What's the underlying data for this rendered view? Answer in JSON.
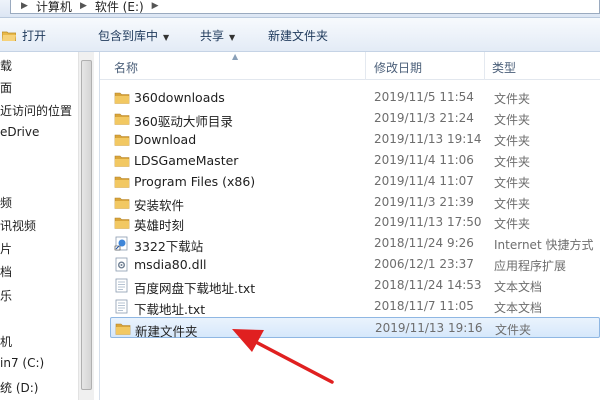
{
  "address": {
    "crumbs": [
      "计算机",
      "软件 (E:)"
    ]
  },
  "toolbar": {
    "open_label": "打开",
    "include_label": "包含到库中",
    "share_label": "共享",
    "new_folder_label": "新建文件夹"
  },
  "nav": {
    "items": [
      {
        "label": "载"
      },
      {
        "label": "面"
      },
      {
        "label": "近访问的位置"
      },
      {
        "label": "eDrive"
      },
      {
        "label": "频"
      },
      {
        "label": "讯视频"
      },
      {
        "label": "片"
      },
      {
        "label": "档"
      },
      {
        "label": "乐"
      },
      {
        "label": "机"
      },
      {
        "label": "in7 (C:)"
      },
      {
        "label": "统 (D:)"
      }
    ]
  },
  "columns": {
    "name": "名称",
    "date": "修改日期",
    "type": "类型"
  },
  "files": [
    {
      "name": "360downloads",
      "date": "2019/11/5 11:54",
      "type": "文件夹",
      "icon": "folder-icon"
    },
    {
      "name": "360驱动大师目录",
      "date": "2019/11/3 21:24",
      "type": "文件夹",
      "icon": "folder-icon"
    },
    {
      "name": "Download",
      "date": "2019/11/13 19:14",
      "type": "文件夹",
      "icon": "folder-icon"
    },
    {
      "name": "LDSGameMaster",
      "date": "2019/11/4 11:06",
      "type": "文件夹",
      "icon": "folder-icon"
    },
    {
      "name": "Program Files (x86)",
      "date": "2019/11/4 11:07",
      "type": "文件夹",
      "icon": "folder-icon"
    },
    {
      "name": "安装软件",
      "date": "2019/11/3 21:39",
      "type": "文件夹",
      "icon": "folder-icon"
    },
    {
      "name": "英雄时刻",
      "date": "2019/11/13 17:50",
      "type": "文件夹",
      "icon": "folder-icon"
    },
    {
      "name": "3322下载站",
      "date": "2018/11/24 9:26",
      "type": "Internet 快捷方式",
      "icon": "internet-shortcut-icon"
    },
    {
      "name": "msdia80.dll",
      "date": "2006/12/1 23:37",
      "type": "应用程序扩展",
      "icon": "dll-file-icon"
    },
    {
      "name": "百度网盘下载地址.txt",
      "date": "2018/11/24 14:53",
      "type": "文本文档",
      "icon": "text-file-icon"
    },
    {
      "name": "下载地址.txt",
      "date": "2018/11/7 11:05",
      "type": "文本文档",
      "icon": "text-file-icon"
    },
    {
      "name": "新建文件夹",
      "date": "2019/11/13 19:16",
      "type": "文件夹",
      "icon": "folder-icon",
      "selected": true
    }
  ],
  "colors": {
    "annotation_arrow": "#e02020",
    "folder": "#e8b84a",
    "selection": "#d6e8fb"
  }
}
